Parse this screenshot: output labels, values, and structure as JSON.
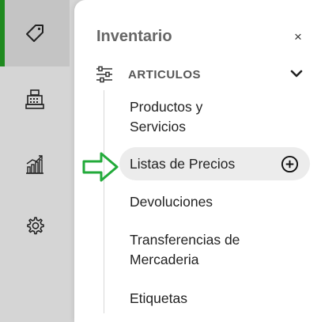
{
  "rail": {
    "items": [
      {
        "icon": "tag-icon",
        "active": true
      },
      {
        "icon": "cash-register-icon",
        "active": false
      },
      {
        "icon": "bar-chart-icon",
        "active": false
      },
      {
        "icon": "gear-icon",
        "active": false
      }
    ]
  },
  "panel": {
    "title": "Inventario",
    "close_label": "×",
    "section": {
      "label": "ARTICULOS",
      "icon": "filter-sliders-icon",
      "chevron": "chevron-down-icon"
    },
    "items": [
      {
        "label_line1": "Productos y",
        "label_line2": "Servicios"
      },
      {
        "label": "Listas de Precios",
        "action_icon": "add-circle-icon"
      },
      {
        "label": "Devoluciones"
      },
      {
        "label_line1": "Transferencias de",
        "label_line2": "Mercaderia"
      },
      {
        "label": "Etiquetas"
      }
    ]
  },
  "colors": {
    "accent_green": "#1f8a1f",
    "annotation_arrow": "#22aa3a"
  }
}
